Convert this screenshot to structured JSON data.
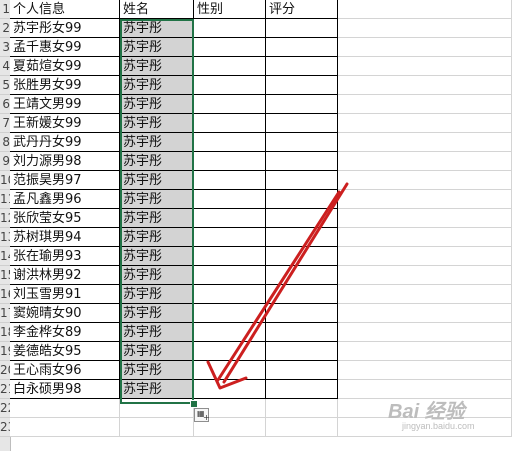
{
  "row_numbers": [
    "1",
    "2",
    "3",
    "4",
    "5",
    "6",
    "7",
    "8",
    "9",
    "10",
    "11",
    "12",
    "13",
    "14",
    "15",
    "16",
    "17",
    "18",
    "19",
    "20",
    "21",
    "22",
    "23"
  ],
  "headers": [
    "个人信息",
    "姓名",
    "性别",
    "评分"
  ],
  "rows": [
    [
      "苏宇彤女99",
      "苏宇彤"
    ],
    [
      "孟千惠女99",
      "苏宇彤"
    ],
    [
      "夏茹煊女99",
      "苏宇彤"
    ],
    [
      "张胜男女99",
      "苏宇彤"
    ],
    [
      "王靖文男99",
      "苏宇彤"
    ],
    [
      "王新媛女99",
      "苏宇彤"
    ],
    [
      "武丹丹女99",
      "苏宇彤"
    ],
    [
      "刘力源男98",
      "苏宇彤"
    ],
    [
      "范振昊男97",
      "苏宇彤"
    ],
    [
      "孟凡鑫男96",
      "苏宇彤"
    ],
    [
      "张欣莹女95",
      "苏宇彤"
    ],
    [
      "苏树琪男94",
      "苏宇彤"
    ],
    [
      "张在瑜男93",
      "苏宇彤"
    ],
    [
      "谢洪林男92",
      "苏宇彤"
    ],
    [
      "刘玉雪男91",
      "苏宇彤"
    ],
    [
      "窦婉晴女90",
      "苏宇彤"
    ],
    [
      "李金桦女89",
      "苏宇彤"
    ],
    [
      "姜德皓女95",
      "苏宇彤"
    ],
    [
      "王心雨女96",
      "苏宇彤"
    ],
    [
      "白永硕男98",
      "苏宇彤"
    ]
  ],
  "selection_color": "#217346",
  "selected_fill": "#d3d3d3",
  "arrow_color": "#cc1f1f",
  "quick_analysis_icon": "quick-analysis-icon",
  "watermark": {
    "brand": "Bai 经验",
    "sub": "jingyan.baidu.com"
  }
}
